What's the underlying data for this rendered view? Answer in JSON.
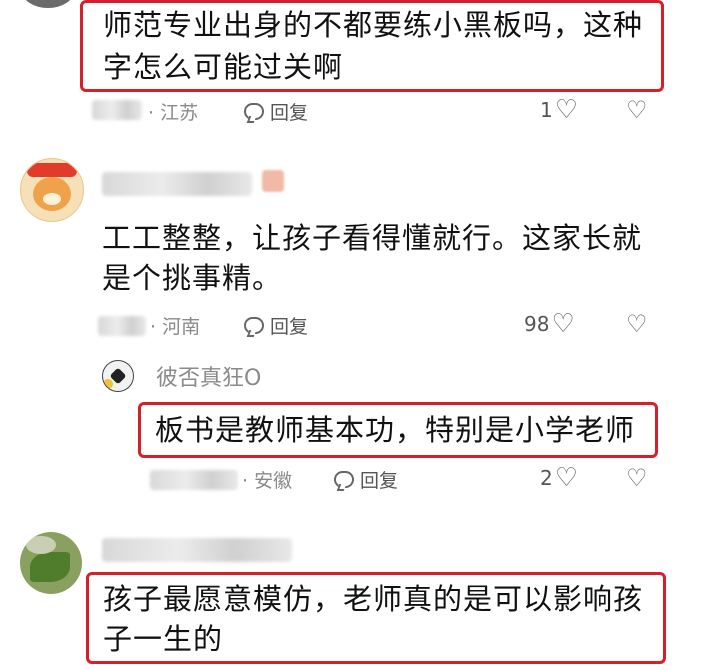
{
  "comments": [
    {
      "text": "师范专业出身的不都要练小黑板吗，这种字怎么可能过关啊",
      "line1": "师范专业出身的不都要练小黑板吗，这种",
      "line2": "字怎么可能过关啊",
      "location": "· 江苏",
      "reply_label": "回复",
      "likes": "1"
    },
    {
      "text": "工工整整，让孩子看得懂就行。这家长就是个挑事精。",
      "line1": "工工整整，让孩子看得懂就行。这家长就",
      "line2": "是个挑事精。",
      "location": "· 河南",
      "reply_label": "回复",
      "likes": "98"
    },
    {
      "username": "彼否真狂O",
      "text": "板书是教师基本功，特别是小学老师",
      "location": "· 安徽",
      "reply_label": "回复",
      "likes": "2"
    },
    {
      "text": "孩子最愿意模仿，老师真的是可以影响孩子一生的",
      "line1": "孩子最愿意模仿，老师真的是可以影响孩",
      "line2": "子一生的"
    }
  ],
  "icons": {
    "like": "heart-outline-icon",
    "dislike": "broken-heart-icon",
    "reply": "comment-bubble-icon"
  },
  "colors": {
    "highlight_border": "#d4202a",
    "meta_text": "#8a8a8a"
  }
}
